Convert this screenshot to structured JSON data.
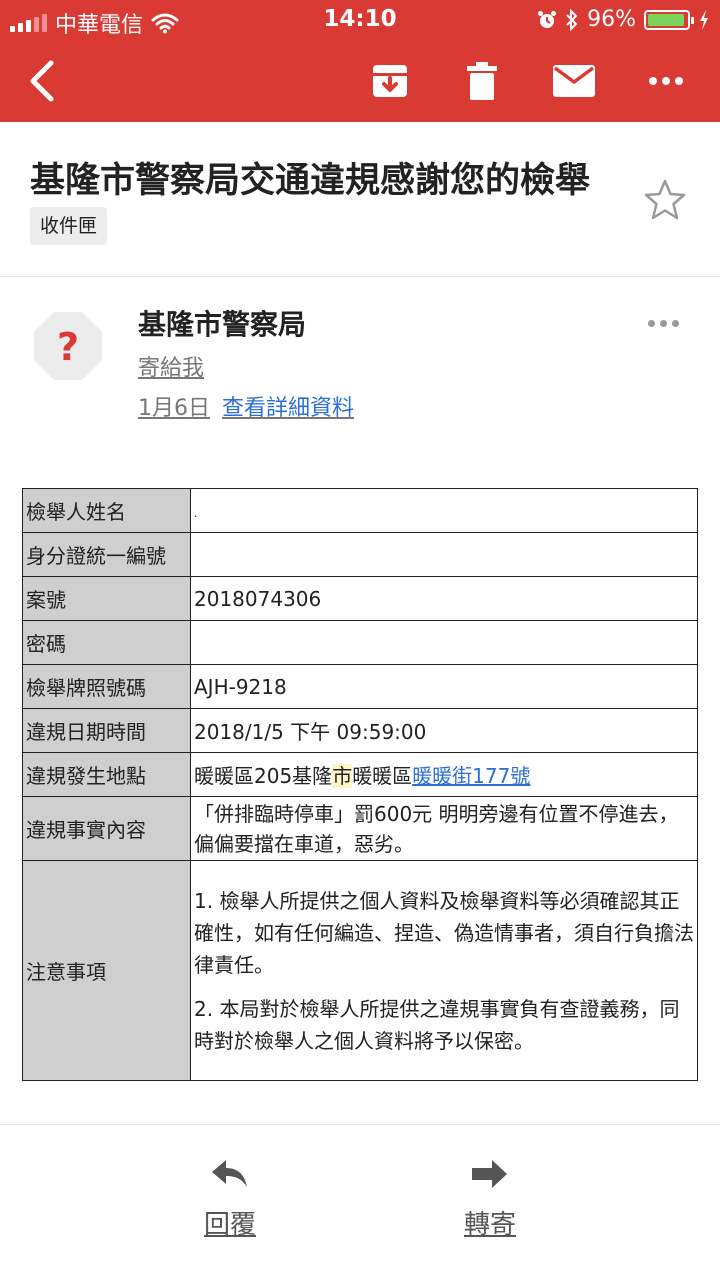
{
  "status_bar": {
    "carrier": "中華電信",
    "time": "14:10",
    "battery": "96%",
    "battery_level": 0.96
  },
  "toolbar": {
    "back_icon": "chevron-left-icon",
    "archive_icon": "archive-icon",
    "delete_icon": "trash-icon",
    "mark_unread_icon": "envelope-icon",
    "more_icon": "more-horizontal-icon"
  },
  "email": {
    "subject": "基隆市警察局交通違規感謝您的檢舉",
    "label": "收件匣",
    "sender": "基隆市警察局",
    "to": "寄給我",
    "date": "1月6日",
    "details_link": "查看詳細資料"
  },
  "table": {
    "rows": [
      {
        "key": "檢舉人姓名",
        "value": "."
      },
      {
        "key": "身分證統一編號",
        "value": ""
      },
      {
        "key": "案號",
        "value": "2018074306"
      },
      {
        "key": "密碼",
        "value": ""
      },
      {
        "key": "檢舉牌照號碼",
        "value": "AJH-9218"
      },
      {
        "key": "違規日期時間",
        "value": "2018/1/5 下午 09:59:00"
      }
    ],
    "location": {
      "key": "違規發生地點",
      "prefix": "暖暖區205基隆",
      "highlight": "市",
      "middle": "暖暖區",
      "link": "暖暖街177號"
    },
    "facts": {
      "key": "違規事實內容",
      "value": "「併排臨時停車」罰600元 明明旁邊有位置不停進去，偏偏要擋在車道，惡劣。"
    },
    "notes": {
      "key": "注意事項",
      "note1": "1. 檢舉人所提供之個人資料及檢舉資料等必須確認其正確性，如有任何編造、捏造、偽造情事者，須自行負擔法律責任。",
      "note2": "2. 本局對於檢舉人所提供之違規事實負有查證義務，同時對於檢舉人之個人資料將予以保密。"
    }
  },
  "actions": {
    "reply": "回覆",
    "forward": "轉寄"
  },
  "colors": {
    "toolbar": "#d93a34",
    "link": "#2b6fd6",
    "key_cell": "#cfcfcf"
  }
}
